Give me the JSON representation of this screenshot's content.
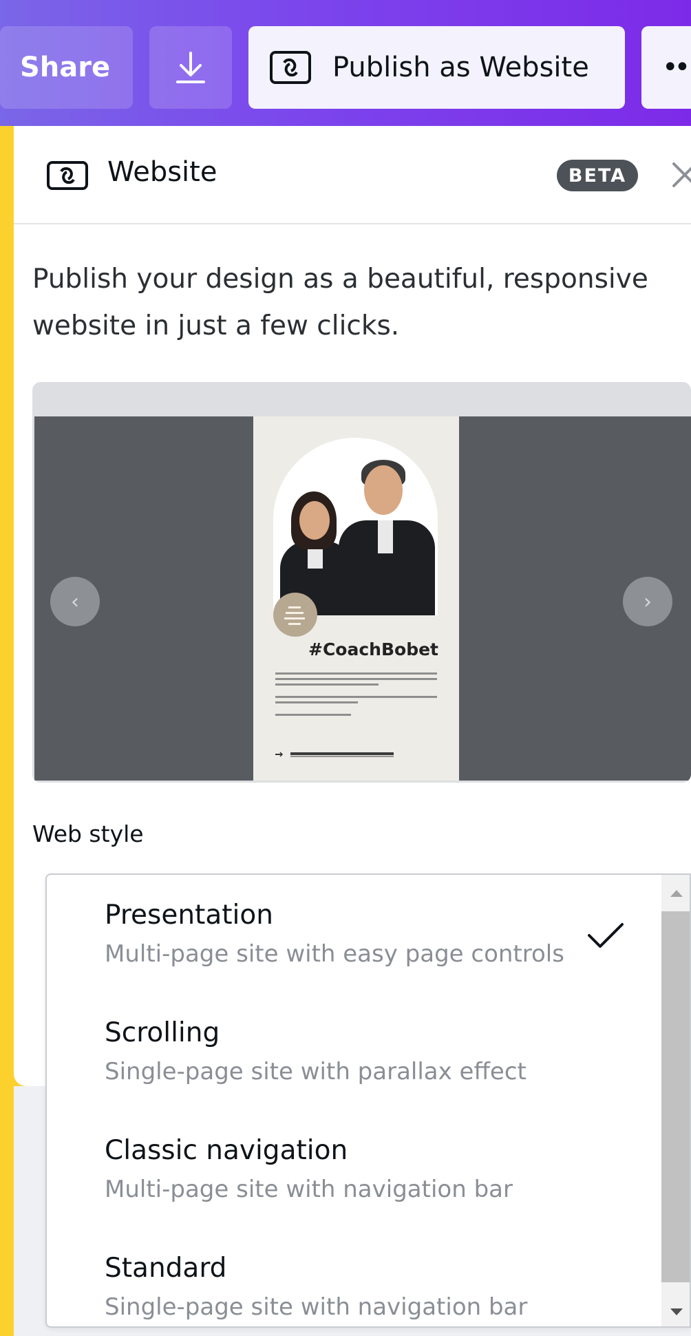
{
  "toolbar": {
    "share_label": "Share",
    "download_icon": "download-icon",
    "publish_label": "Publish as Website",
    "more_label": "••"
  },
  "panel": {
    "title": "Website",
    "badge": "BETA",
    "description": "Publish your design as a beautiful, responsive website in just a few clicks."
  },
  "preview": {
    "poster_title": "#CoachBobet",
    "prev_symbol": "‹",
    "next_symbol": "›"
  },
  "web_style": {
    "label": "Web style",
    "options": [
      {
        "title": "Presentation",
        "desc": "Multi-page site with easy page controls",
        "selected": true
      },
      {
        "title": "Scrolling",
        "desc": "Single-page site with parallax effect",
        "selected": false
      },
      {
        "title": "Classic navigation",
        "desc": "Multi-page site with navigation bar",
        "selected": false
      },
      {
        "title": "Standard",
        "desc": "Single-page site with navigation bar",
        "selected": false
      }
    ]
  },
  "colors": {
    "topbar_start": "#7a66e8",
    "topbar_end": "#7d2ae8",
    "background": "#fcd12e",
    "beta_badge": "#4d5158"
  }
}
